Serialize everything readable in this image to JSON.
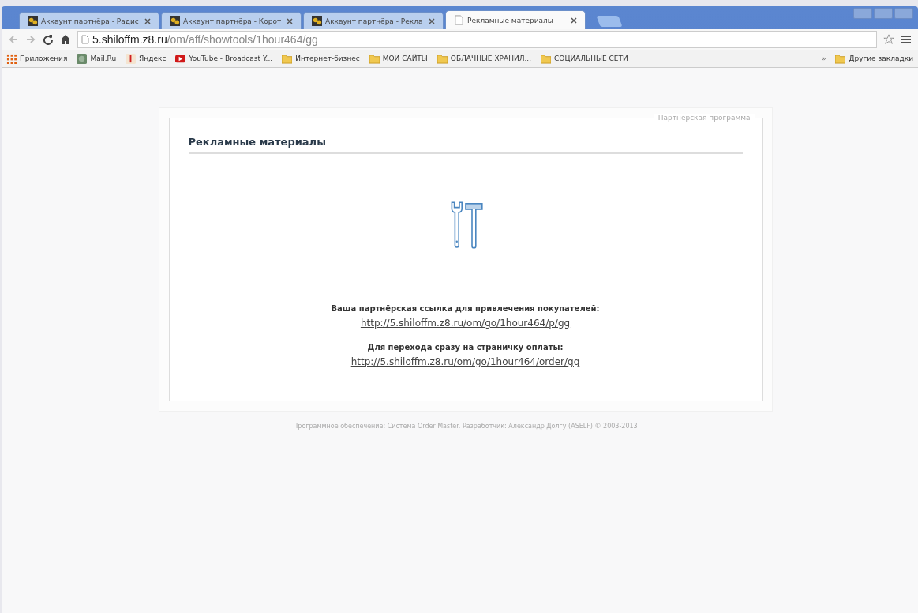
{
  "browser": {
    "tabs": [
      {
        "title": "Аккаунт партнёра - Радис",
        "kind": "site",
        "selected": false
      },
      {
        "title": "Аккаунт партнёра - Корот",
        "kind": "site",
        "selected": false
      },
      {
        "title": "Аккаунт партнёра - Рекла",
        "kind": "site",
        "selected": false
      },
      {
        "title": "Рекламные материалы",
        "kind": "page",
        "selected": true
      }
    ],
    "address": {
      "host": "5.shiloffm.z8.ru",
      "path": "/om/aff/showtools/1hour464/gg"
    },
    "bookmarks": [
      {
        "label": "Приложения",
        "kind": "apps"
      },
      {
        "label": "Mail.Ru",
        "kind": "mail"
      },
      {
        "label": "Яндекс",
        "kind": "yandex"
      },
      {
        "label": "YouTube - Broadcast Y...",
        "kind": "youtube"
      },
      {
        "label": "Интернет-бизнес",
        "kind": "folder"
      },
      {
        "label": "МОИ САЙТЫ",
        "kind": "folder"
      },
      {
        "label": "ОБЛАЧНЫЕ ХРАНИЛ...",
        "kind": "folder"
      },
      {
        "label": "СОЦИАЛЬНЫЕ СЕТИ",
        "kind": "folder"
      }
    ],
    "other_bookmarks": {
      "chevron": "»",
      "label": "Другие закладки"
    }
  },
  "page": {
    "legend": "Партнёрская программа",
    "heading": "Рекламные материалы",
    "sections": [
      {
        "label": "Ваша партнёрская ссылка для привлечения покупателей:",
        "link": "http://5.shiloffm.z8.ru/om/go/1hour464/p/gg"
      },
      {
        "label": "Для перехода сразу на страничку оплаты:",
        "link": "http://5.shiloffm.z8.ru/om/go/1hour464/order/gg"
      }
    ],
    "footer": "Программное обеспечение: Система Order Master. Разработчик: Александр Долгу (ASELF) © 2003-2013"
  }
}
